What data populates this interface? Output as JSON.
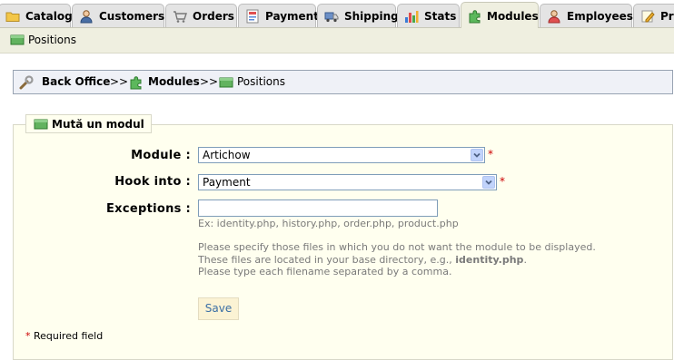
{
  "tabs": [
    {
      "label": "Catalog",
      "icon": "folder-icon",
      "active": false
    },
    {
      "label": "Customers",
      "icon": "user-icon",
      "active": false
    },
    {
      "label": "Orders",
      "icon": "cart-icon",
      "active": false
    },
    {
      "label": "Payment",
      "icon": "payment-icon",
      "active": false
    },
    {
      "label": "Shipping",
      "icon": "truck-icon",
      "active": false
    },
    {
      "label": "Stats",
      "icon": "chart-icon",
      "active": false
    },
    {
      "label": "Modules",
      "icon": "puzzle-icon",
      "active": true
    },
    {
      "label": "Employees",
      "icon": "employee-icon",
      "active": false
    },
    {
      "label": "Pre",
      "icon": "preferences-icon",
      "active": false
    }
  ],
  "subnav": {
    "label": "Positions"
  },
  "breadcrumb": {
    "home": "Back Office",
    "sep": ">>",
    "section": "Modules",
    "current": "Positions"
  },
  "form": {
    "legend": "Mută un modul",
    "module_label": "Module :",
    "module_value": "Artichow",
    "hook_label": "Hook into :",
    "hook_value": "Payment",
    "exceptions_label": "Exceptions :",
    "exceptions_value": "",
    "exceptions_example": "Ex: identity.php, history.php, order.php, product.php",
    "help_line1": "Please specify those files in which you do not want the module to be displayed.",
    "help_line2_prefix": "These files are located in your base directory, e.g., ",
    "help_line2_bold": "identity.php",
    "help_line2_suffix": ".",
    "help_line3": "Please type each filename separated by a comma.",
    "save_label": "Save",
    "required_marker": "*",
    "required_note": "Required field"
  },
  "colors": {
    "active_tab_bg": "#efefe0",
    "inactive_tab_bg": "#e4e4e4",
    "breadcrumb_bg": "#eff1f7",
    "fieldset_bg": "#ffffef",
    "required": "#cc0000",
    "save_text": "#3b6fa5"
  }
}
